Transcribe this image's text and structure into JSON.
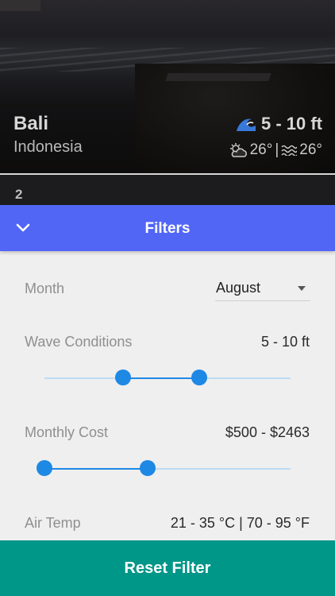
{
  "hero": {
    "city": "Bali",
    "country": "Indonesia",
    "wave_height": "5 - 10 ft",
    "air_temp": "26°",
    "separator": "|",
    "water_temp": "26°",
    "icons": [
      "wave-icon",
      "partly-cloudy-icon",
      "water-waves-icon"
    ]
  },
  "list": {
    "next_rank": "2"
  },
  "header": {
    "title": "Filters",
    "icon": "chevron-down-icon",
    "color": "#5166f5"
  },
  "filters": {
    "month": {
      "label": "Month",
      "selected": "August"
    },
    "wave_conditions": {
      "label": "Wave Conditions",
      "value": "5 - 10 ft",
      "range_fraction": [
        0.32,
        0.63
      ]
    },
    "monthly_cost": {
      "label": "Monthly Cost",
      "value": "$500 - $2463",
      "range_fraction": [
        0.0,
        0.42
      ]
    },
    "air_temp": {
      "label": "Air Temp",
      "value": "21 - 35 °C | 70 - 95 °F"
    }
  },
  "footer": {
    "reset_label": "Reset Filter",
    "color": "#009688"
  },
  "colors": {
    "accent": "#1e88e5",
    "track": "#bcdcf4"
  }
}
